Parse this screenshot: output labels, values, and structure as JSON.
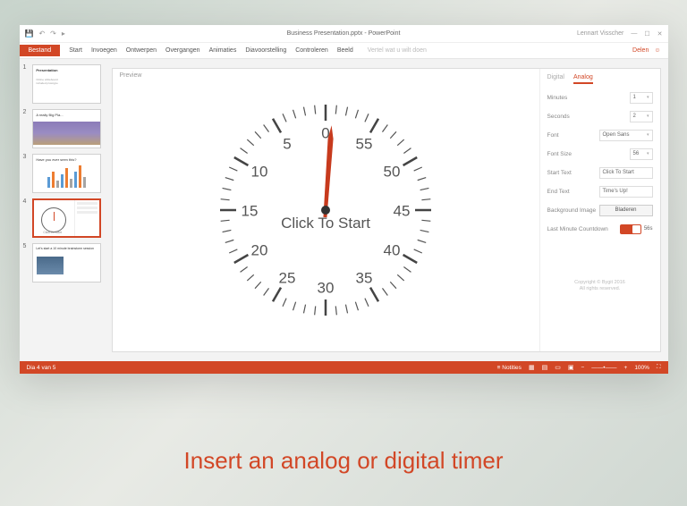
{
  "titlebar": {
    "docTitle": "Business Presentation.pptx - PowerPoint",
    "user": "Lennart Visscher"
  },
  "ribbon": {
    "file": "Bestand",
    "tabs": [
      "Start",
      "Invoegen",
      "Ontwerpen",
      "Overgangen",
      "Animaties",
      "Diavoorstelling",
      "Controleren",
      "Beeld"
    ],
    "tellme": "Vertel wat u wilt doen",
    "share": "Delen"
  },
  "thumbs": {
    "t1": "Presentation",
    "t2": "A really Big Pla...",
    "t3": "Have you ever seen this?",
    "t4": "Click To Start",
    "t5": "Let's start a 10 minute brainstorm session"
  },
  "preview": {
    "label": "Preview"
  },
  "clock": {
    "text": "Click To Start",
    "numbers": {
      "n0": "0",
      "n5": "5",
      "n10": "10",
      "n15": "15",
      "n20": "20",
      "n25": "25",
      "n30": "30",
      "n35": "35",
      "n40": "40",
      "n45": "45",
      "n50": "50",
      "n55": "55"
    }
  },
  "panel": {
    "tabDigital": "Digital",
    "tabAnalog": "Analog",
    "minutes": {
      "label": "Minutes",
      "value": "1"
    },
    "seconds": {
      "label": "Seconds",
      "value": "2"
    },
    "font": {
      "label": "Font",
      "value": "Open Sans"
    },
    "fontSize": {
      "label": "Font Size",
      "value": "56"
    },
    "startText": {
      "label": "Start Text",
      "value": "Click To Start"
    },
    "endText": {
      "label": "End Text",
      "value": "Time's Up!"
    },
    "bgImage": {
      "label": "Background Image",
      "button": "Bladeren"
    },
    "countdown": {
      "label": "Last Minute Countdown",
      "value": "56s"
    },
    "footer1": "Copyright © Bygit 2016",
    "footer2": "All rights reserved."
  },
  "statusbar": {
    "left": "Dia 4 van 5",
    "notes": "Notities",
    "zoom": "100%"
  },
  "caption": "Insert an analog or digital timer"
}
